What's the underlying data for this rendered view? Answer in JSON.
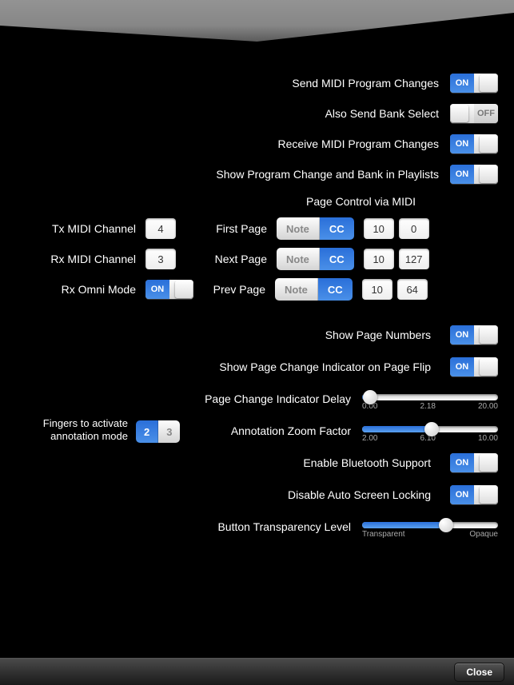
{
  "switch_labels": {
    "on": "ON",
    "off": "OFF"
  },
  "midi": {
    "send_program_changes": {
      "label": "Send MIDI Program Changes",
      "value": true
    },
    "also_send_bank_select": {
      "label": "Also Send Bank Select",
      "value": false
    },
    "receive_program_changes": {
      "label": "Receive MIDI Program Changes",
      "value": true
    },
    "show_in_playlists": {
      "label": "Show Program Change and Bank in Playlists",
      "value": true
    }
  },
  "page_control": {
    "title": "Page Control via MIDI",
    "tx_channel": {
      "label": "Tx MIDI Channel",
      "value": "4"
    },
    "rx_channel": {
      "label": "Rx MIDI Channel",
      "value": "3"
    },
    "rx_omni": {
      "label": "Rx Omni Mode",
      "value": true
    },
    "first_page": {
      "label": "First Page",
      "mode": "CC",
      "cc": "10",
      "val": "0"
    },
    "next_page": {
      "label": "Next Page",
      "mode": "CC",
      "cc": "10",
      "val": "127"
    },
    "prev_page": {
      "label": "Prev Page",
      "mode": "CC",
      "cc": "10",
      "val": "64"
    },
    "seg_options": {
      "note": "Note",
      "cc": "CC"
    }
  },
  "display": {
    "show_page_numbers": {
      "label": "Show Page Numbers",
      "value": true
    },
    "show_indicator": {
      "label": "Show Page Change Indicator on Page Flip",
      "value": true
    },
    "indicator_delay": {
      "label": "Page Change Indicator Delay",
      "min": "0.00",
      "mid": "2.18",
      "max": "20.00",
      "value_percent": 6
    },
    "annotation_fingers": {
      "label": "Fingers to activate annotation mode",
      "options": [
        "2",
        "3"
      ],
      "selected": "2"
    },
    "annotation_zoom": {
      "label": "Annotation Zoom Factor",
      "min": "2.00",
      "mid": "6.10",
      "max": "10.00",
      "value_percent": 51
    },
    "bluetooth": {
      "label": "Enable Bluetooth Support",
      "value": true
    },
    "auto_lock": {
      "label": "Disable Auto Screen Locking",
      "value": true
    },
    "button_transparency": {
      "label": "Button Transparency Level",
      "left": "Transparent",
      "right": "Opaque",
      "value_percent": 62
    }
  },
  "footer": {
    "close": "Close"
  }
}
